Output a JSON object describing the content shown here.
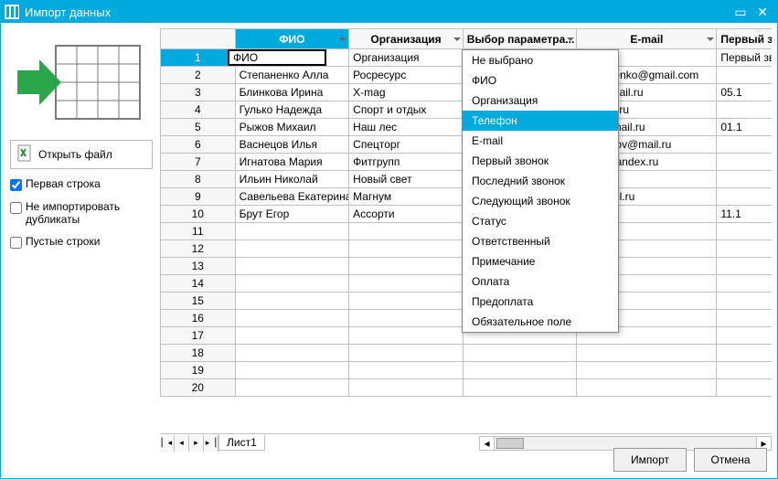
{
  "window": {
    "title": "Импорт данных"
  },
  "left": {
    "openFile": "Открыть файл",
    "firstRow": "Первая строка",
    "noDup": "Не импортировать дубликаты",
    "emptyRows": "Пустые строки"
  },
  "columns": [
    "ФИО",
    "Организация",
    "Выбор параметра...",
    "E-mail",
    "Первый звонок"
  ],
  "selectedCell": "ФИО",
  "rows": [
    {
      "n": "1",
      "a": "ФИО",
      "b": "Организация",
      "c": "",
      "d": "",
      "e": "Первый звонок"
    },
    {
      "n": "2",
      "a": "Степаненко Алла",
      "b": "Росресурс",
      "c": "",
      "d": "stepanenko@gmail.com",
      "e": ""
    },
    {
      "n": "3",
      "a": "Блинкова Ирина",
      "b": "X-mag",
      "c": "",
      "d": "rina@mail.ru",
      "e": "05.1"
    },
    {
      "n": "4",
      "a": "Гулько Надежда",
      "b": "Спорт и отдых",
      "c": "",
      "d": "yandex.ru",
      "e": ""
    },
    {
      "n": "5",
      "a": "Рыжов Михаил",
      "b": "Наш лес",
      "c": "",
      "d": "rijov@mail.ru",
      "e": "01.1"
    },
    {
      "n": "6",
      "a": "Васнецов Илья",
      "b": "Спецторг",
      "c": "",
      "d": "vasnezov@mail.ru",
      "e": ""
    },
    {
      "n": "7",
      "a": "Игнатова Мария",
      "b": "Фитгрупп",
      "c": "",
      "d": "aria@yandex.ru",
      "e": ""
    },
    {
      "n": "8",
      "a": "Ильин Николай",
      "b": "Новый свет",
      "c": "",
      "d": "",
      "e": ""
    },
    {
      "n": "9",
      "a": "Савельева Екатерина",
      "b": "Магнум",
      "c": "",
      "d": "rg@mail.ru",
      "e": ""
    },
    {
      "n": "10",
      "a": "Брут Егор",
      "b": "Ассорти",
      "c": "",
      "d": "",
      "e": "11.1"
    },
    {
      "n": "11"
    },
    {
      "n": "12"
    },
    {
      "n": "13"
    },
    {
      "n": "14"
    },
    {
      "n": "15"
    },
    {
      "n": "16"
    },
    {
      "n": "17"
    },
    {
      "n": "18"
    },
    {
      "n": "19"
    },
    {
      "n": "20"
    }
  ],
  "dropdown": {
    "items": [
      "Не выбрано",
      "ФИО",
      "Организация",
      "Телефон",
      "E-mail",
      "Первый звонок",
      "Последний звонок",
      "Следующий звонок",
      "Статус",
      "Ответственный",
      "Примечание",
      "Оплата",
      "Предоплата",
      "Обязательное поле"
    ],
    "selectedIndex": 3
  },
  "sheet": "Лист1",
  "footer": {
    "import": "Импорт",
    "cancel": "Отмена"
  }
}
